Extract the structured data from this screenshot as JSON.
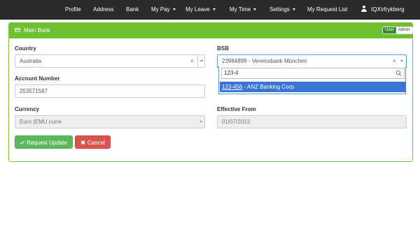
{
  "nav": {
    "items": [
      {
        "label": "Profile",
        "dropdown": false
      },
      {
        "label": "Address",
        "dropdown": false
      },
      {
        "label": "Bank",
        "dropdown": false
      },
      {
        "label": "My Pay",
        "dropdown": true
      },
      {
        "label": "My Leave",
        "dropdown": true
      },
      {
        "label": "My Time",
        "dropdown": true
      },
      {
        "label": "Settings",
        "dropdown": true
      },
      {
        "label": "My Request List",
        "dropdown": false
      }
    ],
    "user": {
      "label": "IQX\\rfrykberg",
      "icon": "user-icon"
    }
  },
  "panel": {
    "title": "Main Bank",
    "icon": "credit-card-icon",
    "toggle": {
      "user": "User",
      "admin": "Admin",
      "active": "User"
    }
  },
  "form": {
    "country": {
      "label": "Country",
      "value": "Australia"
    },
    "bsb": {
      "label": "BSB",
      "value": "23984899 - Vereinsbank München",
      "search": "123-4",
      "options": [
        {
          "match": "123-456",
          "rest": " - ANZ Banking Corp."
        }
      ]
    },
    "account_number": {
      "label": "Account Number",
      "value": "253571587"
    },
    "currency": {
      "label": "Currency",
      "value": "Euro (EMU curre"
    },
    "effective_from": {
      "label": "Effective From",
      "value": "01/07/2013"
    }
  },
  "actions": {
    "request_update": "Request Update",
    "cancel": "Cancel"
  },
  "colors": {
    "nav_bg": "#2b2b2b",
    "panel_header": "#6ec02e",
    "primary_green": "#5cb85c",
    "danger_red": "#d9534f",
    "highlight_blue": "#3875d7"
  }
}
